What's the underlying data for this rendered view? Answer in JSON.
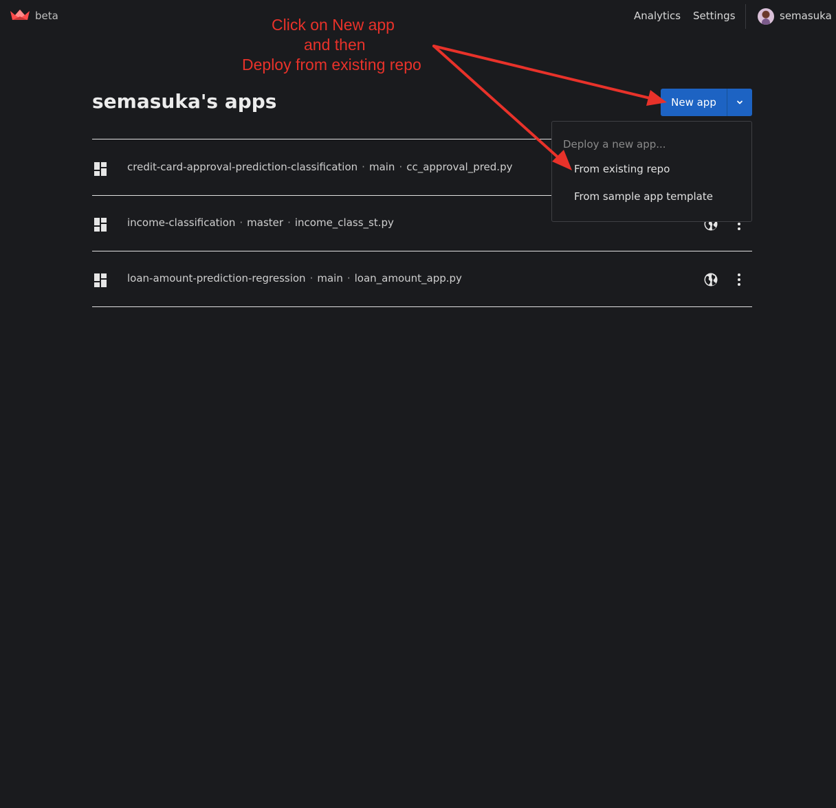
{
  "header": {
    "beta_label": "beta",
    "nav": {
      "analytics": "Analytics",
      "settings": "Settings"
    },
    "username": "semasuka"
  },
  "page": {
    "title": "semasuka's apps"
  },
  "new_app": {
    "label": "New app"
  },
  "apps": [
    {
      "repo": "credit-card-approval-prediction-classification",
      "branch": "main",
      "file": "cc_approval_pred.py"
    },
    {
      "repo": "income-classification",
      "branch": "master",
      "file": "income_class_st.py"
    },
    {
      "repo": "loan-amount-prediction-regression",
      "branch": "main",
      "file": "loan_amount_app.py"
    }
  ],
  "separator": "·",
  "dropdown": {
    "header": "Deploy a new app...",
    "items": [
      "From existing repo",
      "From sample app template"
    ]
  },
  "annotation": {
    "line1": "Click on New app",
    "line2": "and then",
    "line3": "Deploy from existing repo"
  },
  "icons": {
    "logo": "streamlit-crown-icon",
    "row": "dashboard-grid-icon",
    "public": "globe-icon",
    "menu": "kebab-menu-icon",
    "caret": "chevron-down-icon"
  },
  "colors": {
    "background": "#1a1b1e",
    "primary": "#1d63c3",
    "logo": "#ff4b4b",
    "annotation": "#e8322a"
  }
}
